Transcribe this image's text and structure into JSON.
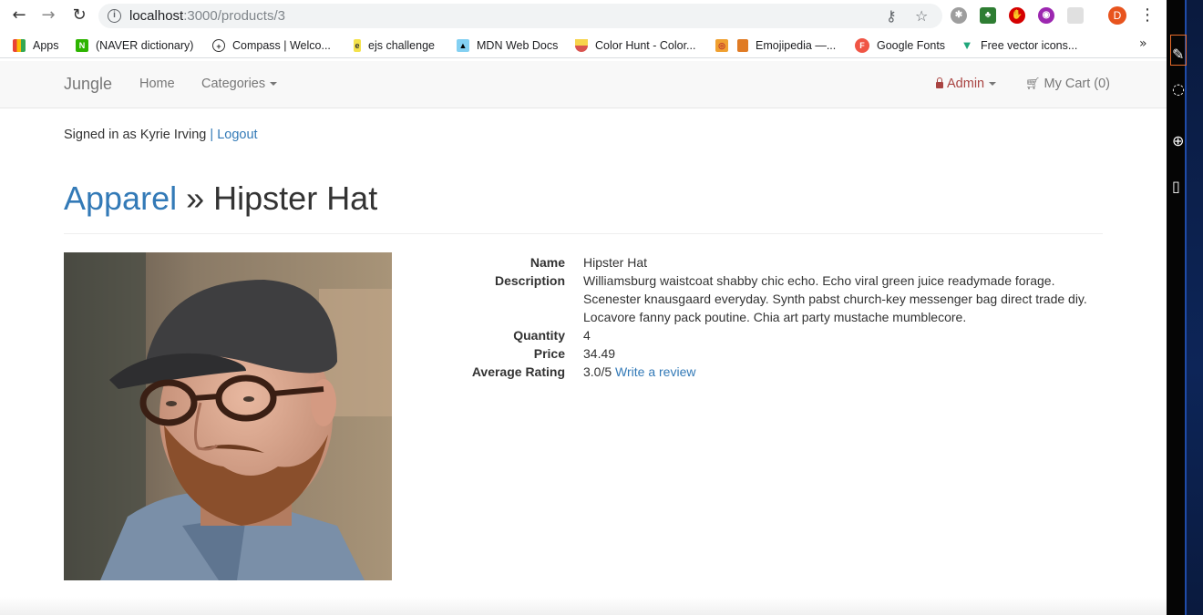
{
  "browser": {
    "url_host": "localhost",
    "url_path": ":3000/products/3",
    "profile_initial": "D",
    "bookmarks": [
      {
        "label": "Apps",
        "icon": "apps-grid-icon",
        "color": "#4285f4"
      },
      {
        "label": "(NAVER dictionary)",
        "icon": "naver-icon",
        "color": "#2db400"
      },
      {
        "label": "Compass | Welco...",
        "icon": "compass-icon",
        "color": "#333333"
      },
      {
        "label": "ejs challenge",
        "icon": "ejs-icon",
        "color": "#b4a000"
      },
      {
        "label": "MDN Web Docs",
        "icon": "mdn-icon",
        "color": "#83d0f2"
      },
      {
        "label": "Color Hunt - Color...",
        "icon": "colorhunt-icon",
        "color": "#d9534f"
      },
      {
        "label": "",
        "icon": "bookmark-icon",
        "color": "#f0a030"
      },
      {
        "label": "Emojipedia —...",
        "icon": "emojipedia-icon",
        "color": "#e07b24"
      },
      {
        "label": "Google Fonts",
        "icon": "google-fonts-icon",
        "color": "#f05545"
      },
      {
        "label": "Free vector icons...",
        "icon": "flaticon-icon",
        "color": "#1fa67a"
      }
    ],
    "more_label": "»"
  },
  "nav": {
    "brand": "Jungle",
    "home": "Home",
    "categories": "Categories",
    "admin": "Admin",
    "cart": "My Cart (0)"
  },
  "session": {
    "signed_in": "Signed in as Kyrie Irving",
    "separator": "|",
    "logout": "Logout"
  },
  "product": {
    "category": "Apparel",
    "separator": "»",
    "name": "Hipster Hat",
    "fields": {
      "name_label": "Name",
      "name_value": "Hipster Hat",
      "description_label": "Description",
      "description_value": "Williamsburg waistcoat shabby chic echo. Echo viral green juice readymade forage. Scenester knausgaard everyday. Synth pabst church-key messenger bag direct trade diy. Locavore fanny pack poutine. Chia art party mustache mumblecore.",
      "quantity_label": "Quantity",
      "quantity_value": "4",
      "price_label": "Price",
      "price_value": "34.49",
      "rating_label": "Average Rating",
      "rating_value": "3.0/5",
      "review_link": "Write a review"
    }
  },
  "colors": {
    "link": "#337ab7",
    "admin": "#a94442",
    "navbar_bg": "#f8f8f8"
  }
}
